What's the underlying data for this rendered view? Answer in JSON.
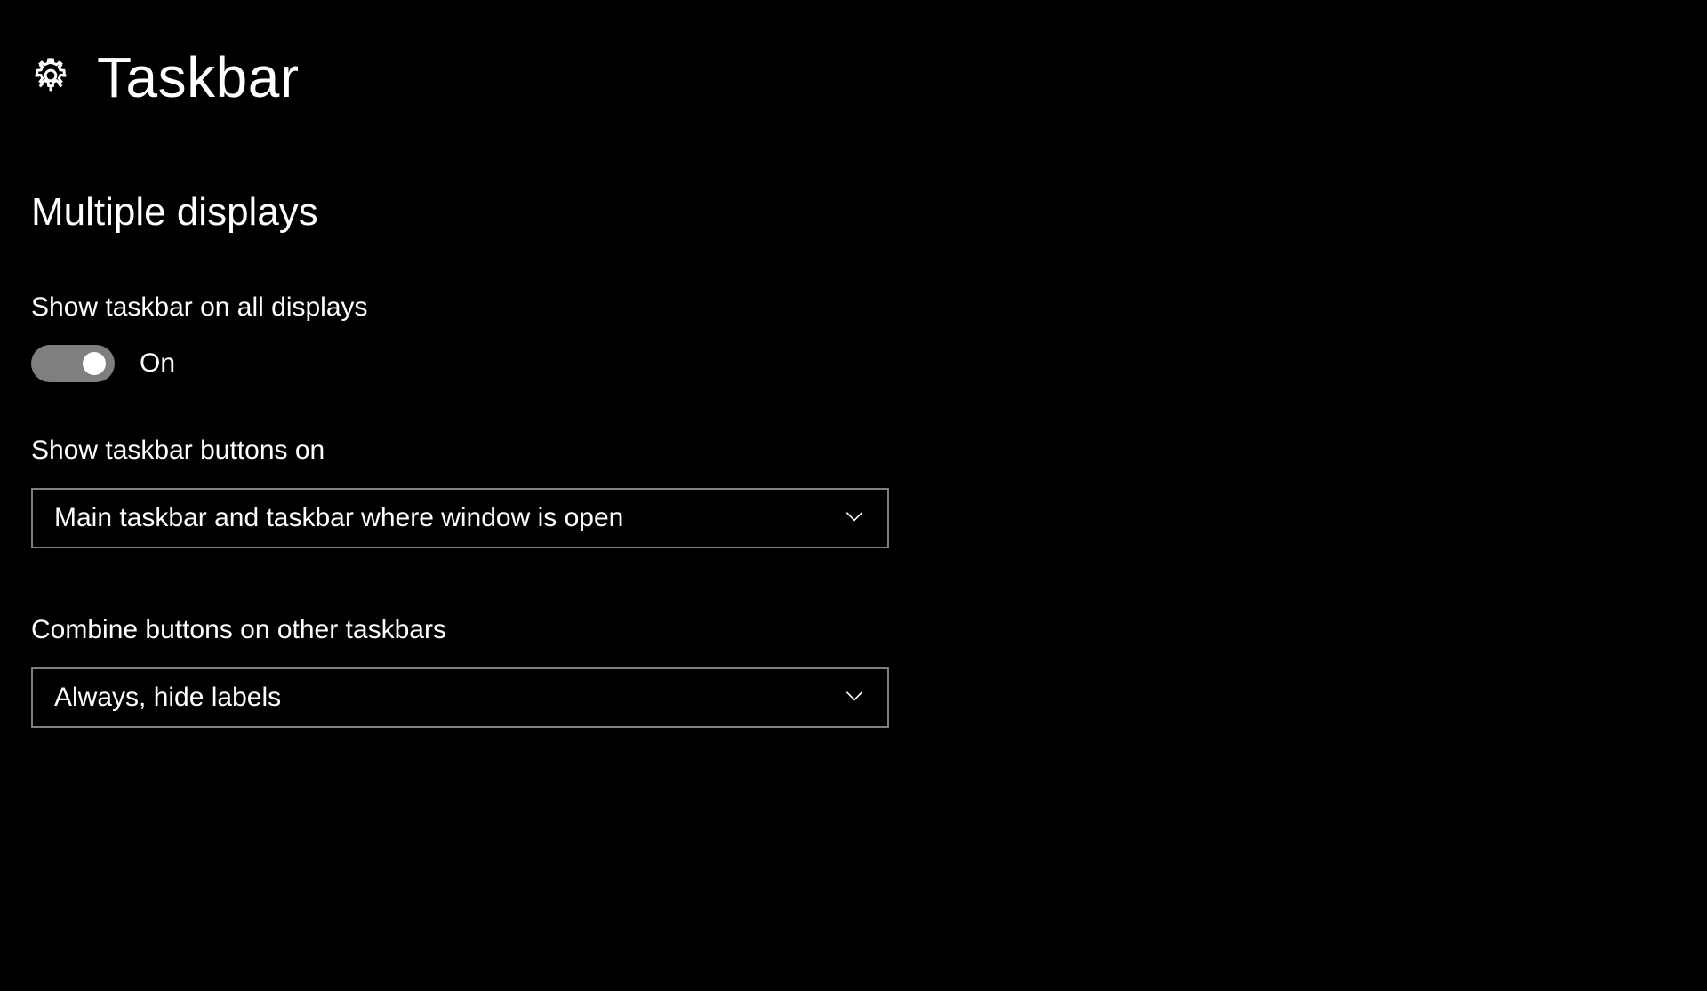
{
  "header": {
    "title": "Taskbar"
  },
  "section": {
    "heading": "Multiple displays",
    "settings": {
      "show_taskbar_all": {
        "label": "Show taskbar on all displays",
        "state": "On"
      },
      "show_buttons_on": {
        "label": "Show taskbar buttons on",
        "selected": "Main taskbar and taskbar where window is open"
      },
      "combine_buttons": {
        "label": "Combine buttons on other taskbars",
        "selected": "Always, hide labels"
      }
    }
  }
}
